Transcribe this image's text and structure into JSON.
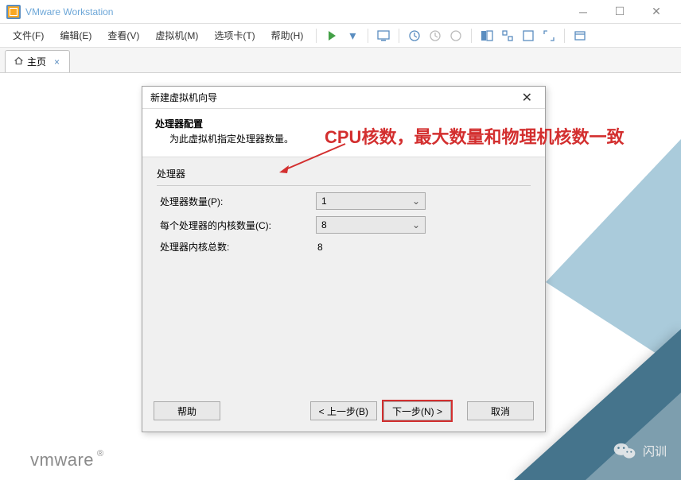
{
  "window": {
    "title": "VMware Workstation"
  },
  "menus": {
    "file": "文件(F)",
    "edit": "编辑(E)",
    "view": "查看(V)",
    "vm": "虚拟机(M)",
    "tabs": "选项卡(T)",
    "help": "帮助(H)"
  },
  "tabs": {
    "home": {
      "label": "主页",
      "close": "×"
    }
  },
  "dialog": {
    "title": "新建虚拟机向导",
    "heading": "处理器配置",
    "subheading": "为此虚拟机指定处理器数量。",
    "group": "处理器",
    "rows": {
      "proc_count_label": "处理器数量(P):",
      "proc_count_value": "1",
      "cores_label": "每个处理器的内核数量(C):",
      "cores_value": "8",
      "total_label": "处理器内核总数:",
      "total_value": "8"
    },
    "buttons": {
      "help": "帮助",
      "back": "< 上一步(B)",
      "next": "下一步(N) >",
      "cancel": "取消"
    }
  },
  "annotation": {
    "text": "CPU核数，最大数量和物理机核数一致"
  },
  "footer": {
    "logo": "vmware",
    "reg": "®"
  },
  "watermark": {
    "label": "闪训"
  }
}
